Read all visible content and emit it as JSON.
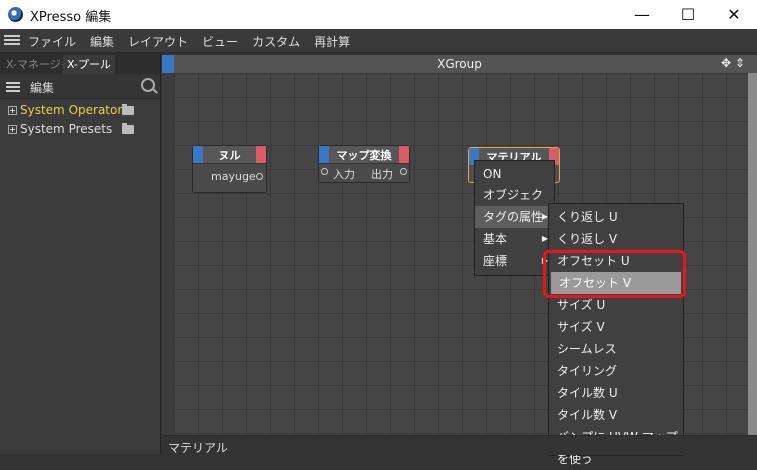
{
  "window": {
    "title": "XPresso 編集",
    "controls": {
      "minimize": "—",
      "maximize": "☐",
      "close": "✕"
    }
  },
  "menubar": {
    "items": [
      "ファイル",
      "編集",
      "レイアウト",
      "ビュー",
      "カスタム",
      "再計算"
    ]
  },
  "left_panel": {
    "tabs": [
      "X-マネージャ",
      "X-プール"
    ],
    "toolbar_label": "編集",
    "tree": [
      {
        "label": "System Operators",
        "color": "#e6d04a"
      },
      {
        "label": "System Presets",
        "color": "#dddddd"
      }
    ]
  },
  "editor": {
    "group_title": "XGroup",
    "nodes": [
      {
        "title": "ヌル",
        "port_out": "mayuge"
      },
      {
        "title": "マップ変換",
        "port_in": "入力",
        "port_out": "出力"
      },
      {
        "title": "マテリアル"
      }
    ]
  },
  "context_menu": {
    "items": [
      {
        "label": "ON",
        "submenu": false
      },
      {
        "label": "オブジェクト",
        "submenu": false
      },
      {
        "label": "タグの属性",
        "submenu": true,
        "highlighted": true
      },
      {
        "label": "基本",
        "submenu": true
      },
      {
        "label": "座標",
        "submenu": true
      }
    ]
  },
  "submenu": {
    "items": [
      {
        "label": "くり返し U"
      },
      {
        "label": "くり返し V"
      },
      {
        "label": "オフセット U"
      },
      {
        "label": "オフセット V",
        "highlighted": true
      },
      {
        "label": "サイズ U"
      },
      {
        "label": "サイズ V"
      },
      {
        "label": "シームレス"
      },
      {
        "label": "タイリング"
      },
      {
        "label": "タイル数 U"
      },
      {
        "label": "タイル数 V"
      },
      {
        "label": "バンプに UVW マップを使う"
      }
    ]
  },
  "statusbar": {
    "text": "マテリアル"
  },
  "colors": {
    "accent_blue": "#3a78c5",
    "port_red": "#d95c6a",
    "highlight_box": "#e8141e",
    "selection_orange": "#e2a63a"
  }
}
